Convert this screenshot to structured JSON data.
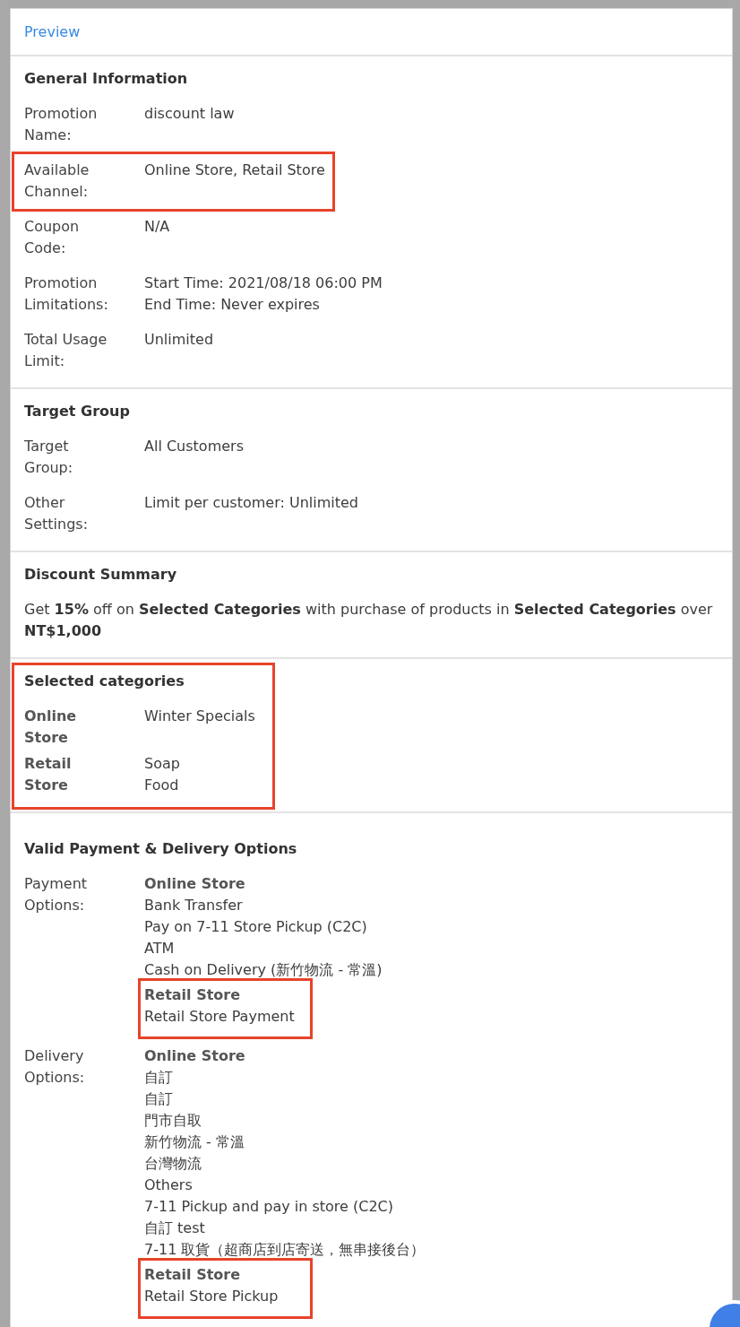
{
  "panel": {
    "title": "Preview"
  },
  "sections": [
    {
      "kind": "fields",
      "title": "General Information",
      "highlighted": false,
      "rows": [
        {
          "label": "Promotion Name:",
          "values": [
            "discount law"
          ],
          "highlighted": false
        },
        {
          "label": "Available Channel:",
          "values": [
            "Online Store, Retail Store"
          ],
          "highlighted": true
        },
        {
          "label": "Coupon Code:",
          "values": [
            "N/A"
          ],
          "highlighted": false
        },
        {
          "label": "Promotion Limitations:",
          "values": [
            "Start Time: 2021/08/18 06:00 PM",
            "End Time: Never expires"
          ],
          "highlighted": false
        },
        {
          "label": "Total Usage Limit:",
          "values": [
            "Unlimited"
          ],
          "highlighted": false
        }
      ]
    },
    {
      "kind": "fields",
      "title": "Target Group",
      "highlighted": false,
      "rows": [
        {
          "label": "Target Group:",
          "values": [
            "All Customers"
          ],
          "highlighted": false
        },
        {
          "label": "Other Settings:",
          "values": [
            "Limit per customer: Unlimited"
          ],
          "highlighted": false
        }
      ]
    },
    {
      "kind": "summary",
      "title": "Discount Summary",
      "highlighted": false,
      "text": "Get **15%** off on **Selected Categories** with purchase of products in **Selected Categories** over **NT$1,000**"
    },
    {
      "kind": "categories",
      "title": "Selected categories",
      "highlighted": true,
      "rows": [
        {
          "label": "Online Store",
          "values": [
            "Winter Specials"
          ]
        },
        {
          "label": "Retail Store",
          "values": [
            "Soap",
            "Food"
          ]
        }
      ]
    },
    {
      "kind": "options",
      "title": "Valid Payment & Delivery Options",
      "highlighted": false,
      "rows": [
        {
          "label": "Payment Options:",
          "groups": [
            {
              "channel": "Online Store",
              "items": [
                "Bank Transfer",
                "Pay on 7-11 Store Pickup (C2C)",
                "ATM",
                "Cash on Delivery (新竹物流 - 常溫)"
              ],
              "highlighted": false
            },
            {
              "channel": "Retail Store",
              "items": [
                "Retail Store Payment"
              ],
              "highlighted": true
            }
          ]
        },
        {
          "label": "Delivery Options:",
          "groups": [
            {
              "channel": "Online Store",
              "items": [
                "自訂",
                "自訂",
                "門市自取",
                "新竹物流 - 常溫",
                "台灣物流",
                "Others",
                "7-11 Pickup and pay in store (C2C)",
                "自訂 test",
                "7-11 取貨（超商店到店寄送，無串接後台）"
              ],
              "highlighted": false
            },
            {
              "channel": "Retail Store",
              "items": [
                "Retail Store Pickup"
              ],
              "highlighted": true
            }
          ]
        }
      ]
    }
  ]
}
